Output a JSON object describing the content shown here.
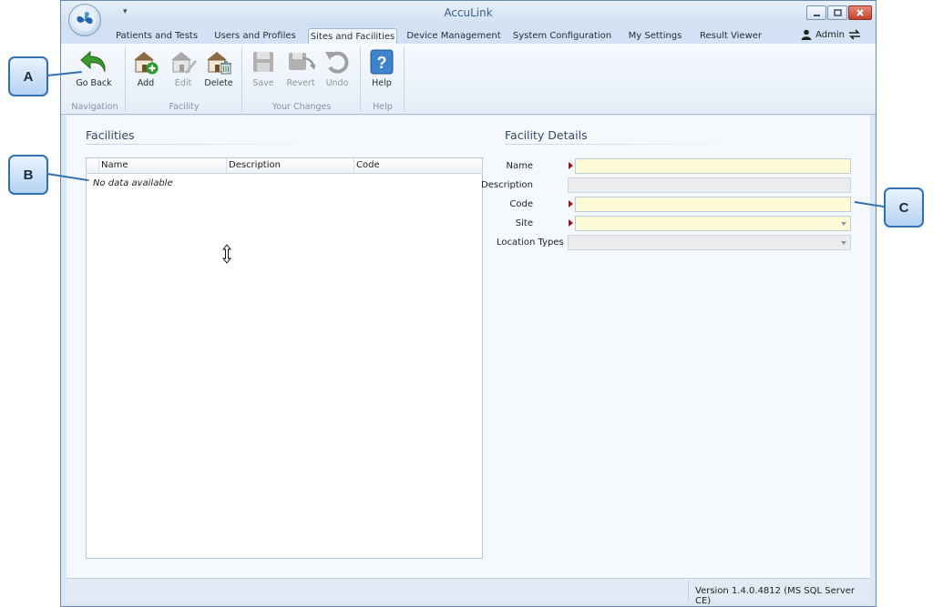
{
  "app": {
    "title": "AccuLink",
    "qat_symbol": "▾"
  },
  "tabs": [
    {
      "label": "Patients and Tests"
    },
    {
      "label": "Users and Profiles"
    },
    {
      "label": "Sites and Facilities",
      "active": true
    },
    {
      "label": "Device Management"
    },
    {
      "label": "System Configuration"
    },
    {
      "label": "My Settings"
    },
    {
      "label": "Result Viewer"
    }
  ],
  "user": {
    "name": "Admin"
  },
  "ribbon": {
    "buttons": [
      {
        "label": "Go Back",
        "icon": "go-back-icon",
        "enabled": true
      },
      {
        "label": "Add",
        "icon": "add-facility-icon",
        "enabled": true
      },
      {
        "label": "Edit",
        "icon": "edit-facility-icon",
        "enabled": false
      },
      {
        "label": "Delete",
        "icon": "delete-facility-icon",
        "enabled": true
      },
      {
        "label": "Save",
        "icon": "save-icon",
        "enabled": false
      },
      {
        "label": "Revert",
        "icon": "revert-icon",
        "enabled": false
      },
      {
        "label": "Undo",
        "icon": "undo-icon",
        "enabled": false
      },
      {
        "label": "Help",
        "icon": "help-icon",
        "enabled": true
      }
    ],
    "groups": [
      {
        "label": "Navigation"
      },
      {
        "label": "Facility"
      },
      {
        "label": "Your Changes"
      },
      {
        "label": "Help"
      }
    ]
  },
  "facilities": {
    "title": "Facilities",
    "columns": [
      "Name",
      "Description",
      "Code"
    ],
    "empty_text": "No data available"
  },
  "details": {
    "title": "Facility Details",
    "fields": [
      {
        "label": "Name",
        "required": true,
        "value": ""
      },
      {
        "label": "Description",
        "required": false,
        "value": ""
      },
      {
        "label": "Code",
        "required": true,
        "value": ""
      },
      {
        "label": "Site",
        "required": true,
        "value": ""
      },
      {
        "label": "Location Types",
        "required": false,
        "value": ""
      }
    ]
  },
  "status": {
    "version": "Version 1.4.0.4812 (MS SQL Server CE)"
  },
  "callouts": [
    {
      "label": "A"
    },
    {
      "label": "B"
    },
    {
      "label": "C"
    }
  ],
  "colors": {
    "accent": "#2f6fb4",
    "required_marker": "#a1141c",
    "required_field_bg": "#fdfad7"
  }
}
